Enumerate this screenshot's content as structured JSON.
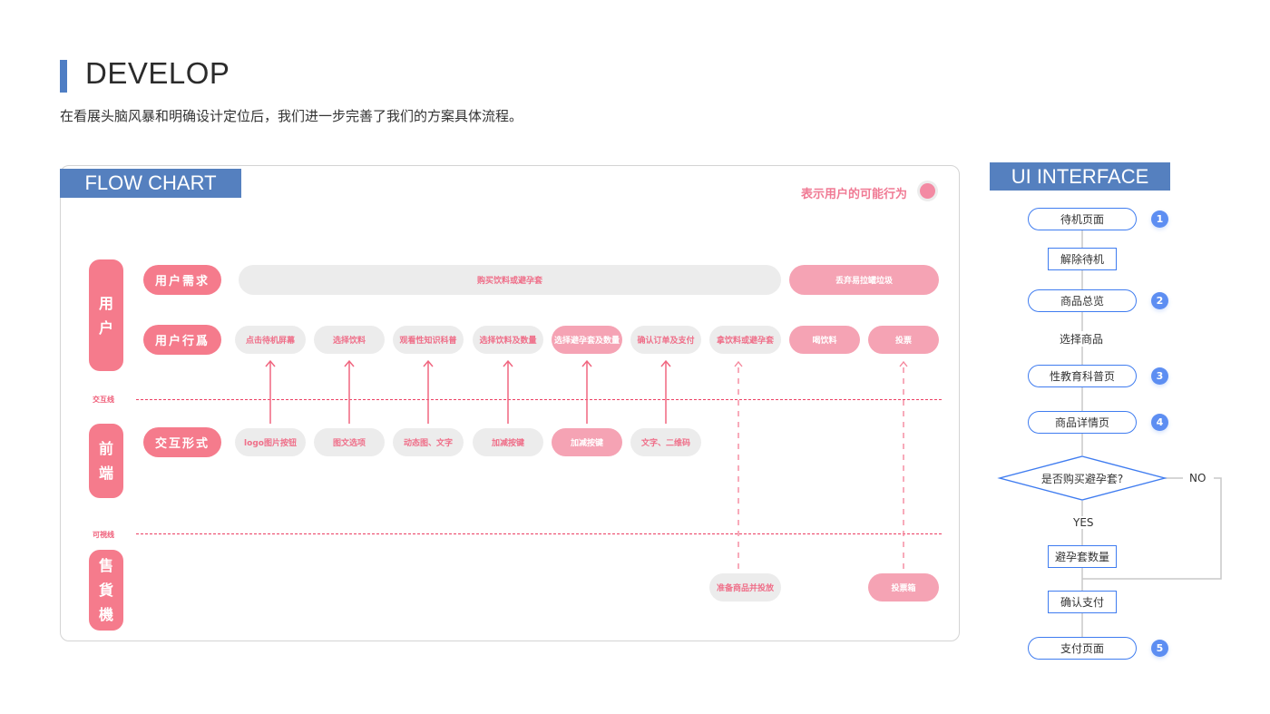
{
  "header": {
    "title": "DEVELOP",
    "subtitle": "在看展头脑风暴和明确设计定位后，我们进一步完善了我们的方案具体流程。"
  },
  "flow_chart": {
    "tag": "FLOW CHART",
    "legend": {
      "text": "表示用户的可能行为",
      "color": "#f38aa3"
    },
    "colors": {
      "accent": "#f57b8c",
      "possible": "#f5a3b4",
      "neutral": "#ececec",
      "line": "#ec3f63"
    },
    "lanes": [
      {
        "label": [
          "用",
          "户"
        ]
      },
      {
        "label": [
          "前",
          "端"
        ]
      },
      {
        "label": [
          "售",
          "貨",
          "機"
        ]
      }
    ],
    "line_labels": {
      "interaction": "交互线",
      "visibility": "可視线"
    },
    "rows": {
      "need": {
        "label": "用户需求",
        "items": [
          {
            "text": "购买饮料或避孕套",
            "type": "grey"
          },
          {
            "text": "丢弃易拉罐垃圾",
            "type": "pink"
          }
        ]
      },
      "behavior": {
        "label": "用户行爲",
        "items": [
          {
            "text": "点击待机屏幕",
            "type": "grey"
          },
          {
            "text": "选择饮料",
            "type": "grey"
          },
          {
            "text": "观看性知识科普",
            "type": "grey"
          },
          {
            "text": "选择饮料及数量",
            "type": "grey"
          },
          {
            "text": "选择避孕套及数量",
            "type": "pink"
          },
          {
            "text": "确认订单及支付",
            "type": "grey"
          },
          {
            "text": "拿饮料或避孕套",
            "type": "grey"
          },
          {
            "text": "喝饮料",
            "type": "pink"
          },
          {
            "text": "投票",
            "type": "pink"
          }
        ]
      },
      "interaction": {
        "label": "交互形式",
        "items": [
          {
            "text": "logo图片按钮",
            "type": "grey"
          },
          {
            "text": "图文选项",
            "type": "grey"
          },
          {
            "text": "动态图、文字",
            "type": "grey"
          },
          {
            "text": "加减按键",
            "type": "grey"
          },
          {
            "text": "加减按键",
            "type": "pink"
          },
          {
            "text": "文字、二维码",
            "type": "grey"
          }
        ]
      },
      "machine": {
        "items": [
          {
            "text": "准备商品并投放",
            "type": "grey"
          },
          {
            "text": "投票箱",
            "type": "pink"
          }
        ]
      }
    }
  },
  "ui_interface": {
    "tag": "UI INTERFACE",
    "colors": {
      "node_border": "#3f7cf0",
      "badge": "#5d8ef2",
      "connector": "#c8c8c8"
    },
    "steps": [
      {
        "text": "待机页面",
        "kind": "page",
        "badge": "1"
      },
      {
        "text": "解除待机",
        "kind": "action"
      },
      {
        "text": "商品总览",
        "kind": "page",
        "badge": "2"
      },
      {
        "text": "选择商品",
        "kind": "label"
      },
      {
        "text": "性教育科普页",
        "kind": "page",
        "badge": "3"
      },
      {
        "text": "商品详情页",
        "kind": "page",
        "badge": "4"
      },
      {
        "text": "是否购买避孕套?",
        "kind": "decision"
      },
      {
        "text": "YES",
        "kind": "label"
      },
      {
        "text": "NO",
        "kind": "label"
      },
      {
        "text": "避孕套数量",
        "kind": "action"
      },
      {
        "text": "确认支付",
        "kind": "action"
      },
      {
        "text": "支付页面",
        "kind": "page",
        "badge": "5"
      }
    ]
  }
}
